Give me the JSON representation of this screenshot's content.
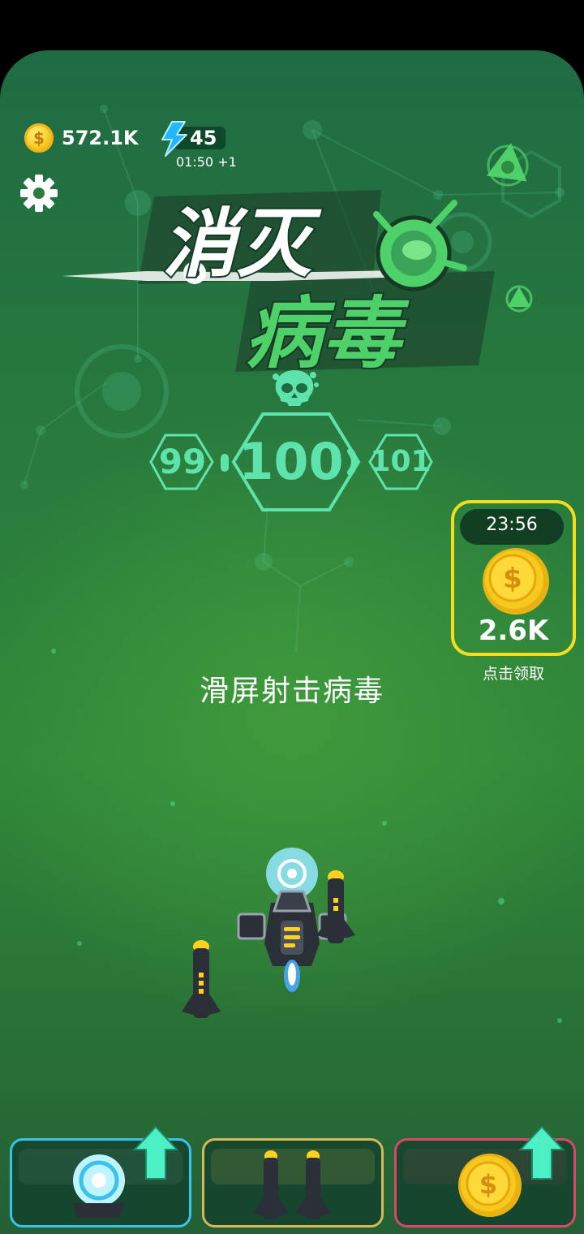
{
  "hud": {
    "coins": "572.1K",
    "energy": "45",
    "energy_timer": "01:50 +1"
  },
  "title": {
    "line1": "消灭",
    "line2": "病毒"
  },
  "levels": {
    "previous": "99",
    "current": "100",
    "next": "101"
  },
  "reward": {
    "timer": "23:56",
    "amount": "2.6K",
    "label": "点击领取",
    "coin_symbol": "$"
  },
  "hint": "滑屏射击病毒",
  "upgrades": [
    {
      "name": "shield",
      "border": "#39c3ea",
      "icon": "shield-orb-icon",
      "has_arrow": true
    },
    {
      "name": "wingmen",
      "border": "#d8b65a",
      "icon": "missile-pair-icon",
      "has_arrow": false
    },
    {
      "name": "coins",
      "border": "#e0446a",
      "icon": "coin-icon",
      "has_arrow": true,
      "coin_symbol": "$"
    }
  ],
  "colors": {
    "background": "#2a7d3c",
    "level_text": "#5ee3ad",
    "title_green": "#4fd16a",
    "reward_border": "#f4dd1f",
    "coin_gold": "#f7c81e"
  }
}
